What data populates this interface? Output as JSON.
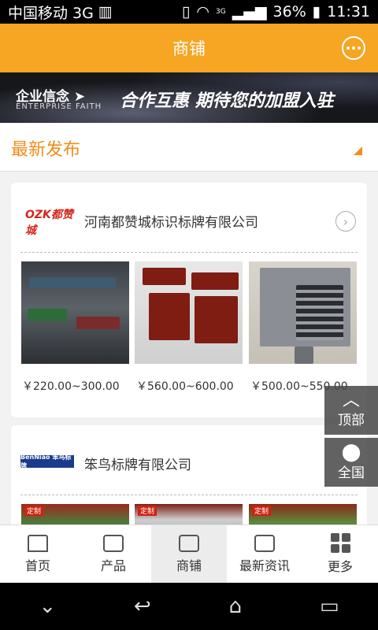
{
  "status": {
    "carrier": "中国移动 3G",
    "net": "3G",
    "battery": "36%",
    "time": "11:31"
  },
  "header": {
    "title": "商铺"
  },
  "banner": {
    "line1": "企业信念 ➤",
    "line2": "ENTERPRISE FAITH",
    "slogan": "合作互惠  期待您的加盟入驻"
  },
  "section": {
    "title": "最新发布"
  },
  "shops": [
    {
      "name": "河南都赞城标识标牌有限公司",
      "logo": "OZK都赞城",
      "prices": [
        "￥220.00~300.00",
        "￥560.00~600.00",
        "￥500.00~550.00"
      ]
    },
    {
      "name": "笨鸟标牌有限公司",
      "logo": "BenNiao 笨鸟标牌",
      "tags": [
        "定制",
        "定制",
        "定制"
      ]
    }
  ],
  "float": {
    "top": "顶部",
    "region": "全国"
  },
  "tabs": [
    {
      "label": "首页"
    },
    {
      "label": "产品"
    },
    {
      "label": "商铺"
    },
    {
      "label": "最新资讯"
    },
    {
      "label": "更多"
    }
  ],
  "colors": {
    "accent": "#f6a623",
    "section_title": "#f28c1a"
  }
}
